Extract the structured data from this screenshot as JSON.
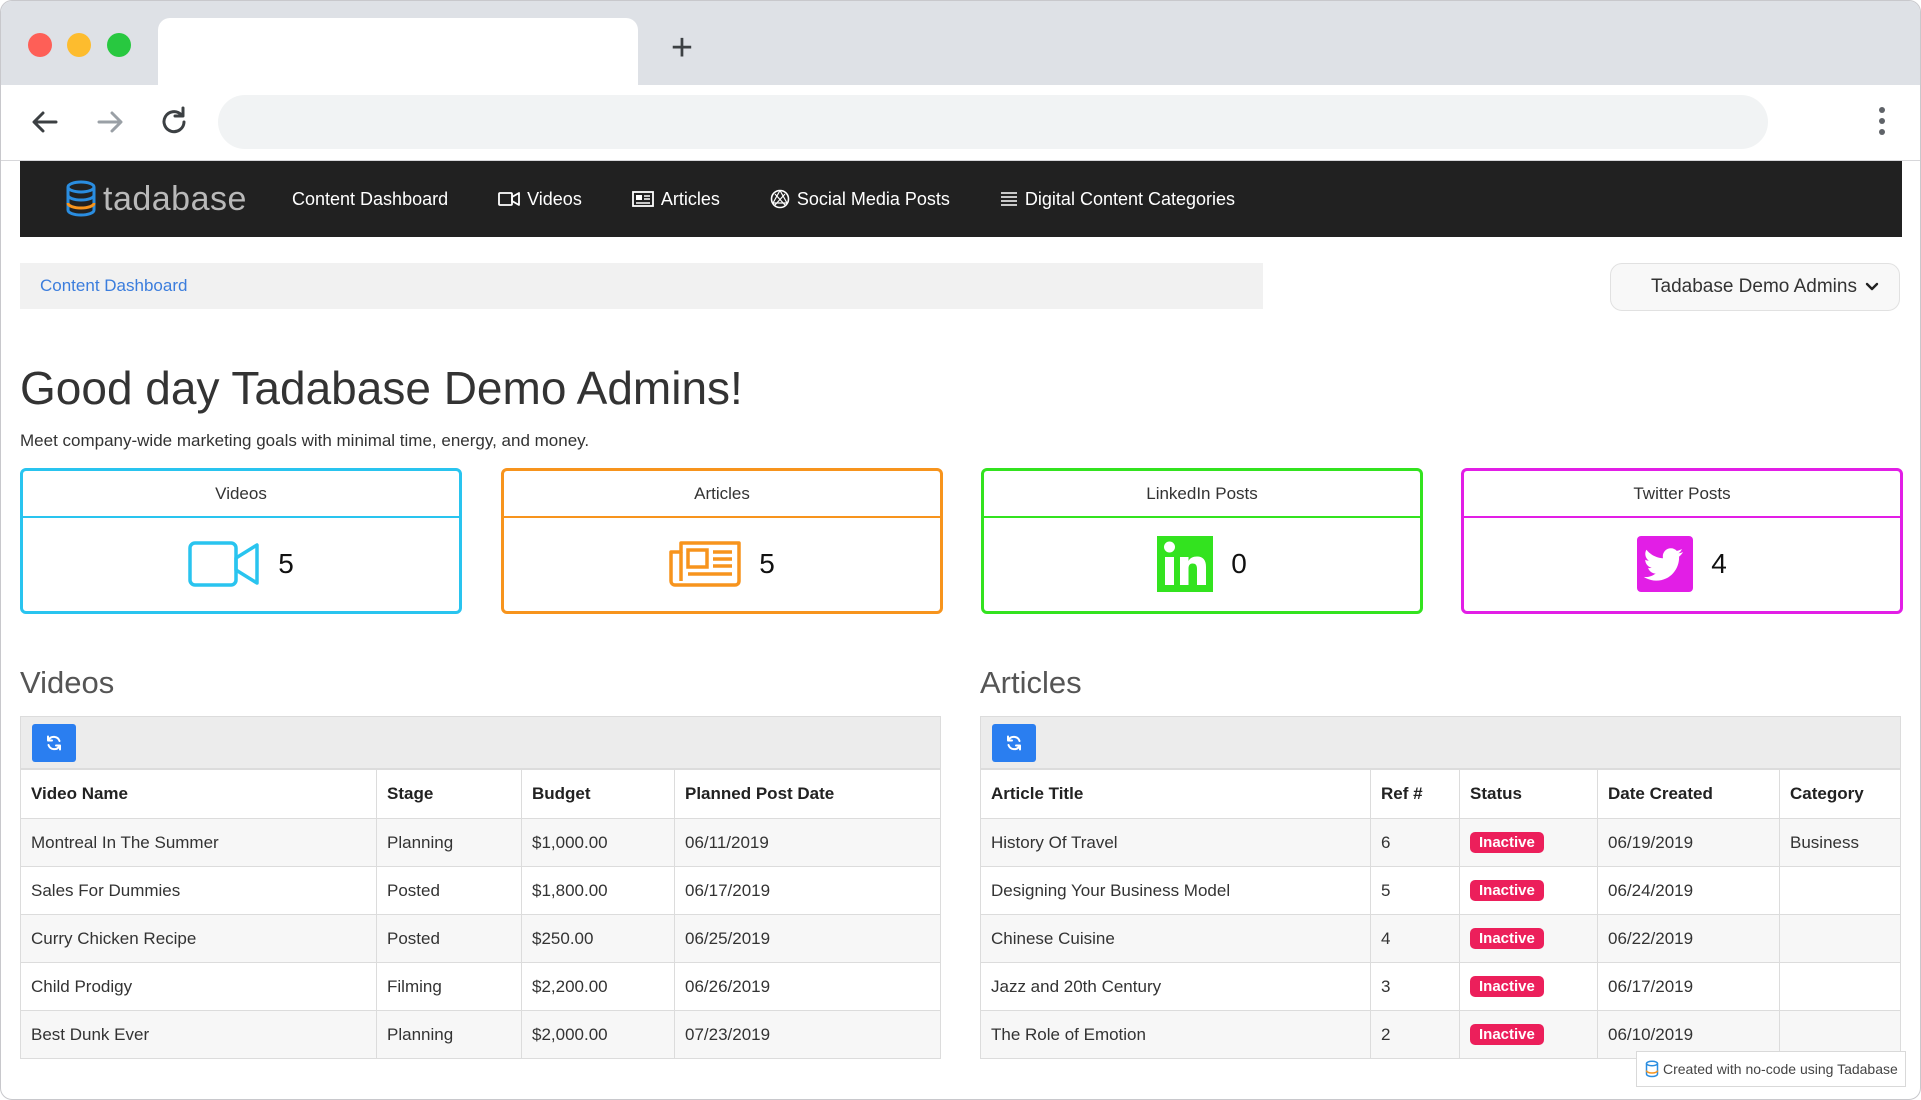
{
  "nav": {
    "logo_text": "tadabase",
    "items": [
      {
        "label": "Content Dashboard",
        "icon": "none"
      },
      {
        "label": "Videos",
        "icon": "video-icon"
      },
      {
        "label": "Articles",
        "icon": "newspaper-icon"
      },
      {
        "label": "Social Media Posts",
        "icon": "globe-icon"
      },
      {
        "label": "Digital Content Categories",
        "icon": "list-icon"
      }
    ]
  },
  "breadcrumb": "Content Dashboard",
  "user_menu": {
    "label": "Tadabase Demo Admins"
  },
  "greeting": "Good day Tadabase Demo Admins!",
  "subtitle": "Meet company-wide marketing goals with minimal time, energy, and money.",
  "stats": [
    {
      "title": "Videos",
      "count": "5",
      "icon": "video-camera-icon",
      "color": "#29c4ef"
    },
    {
      "title": "Articles",
      "count": "5",
      "icon": "newspaper-icon",
      "color": "#f7941d"
    },
    {
      "title": "LinkedIn Posts",
      "count": "0",
      "icon": "linkedin-icon",
      "color": "#33e31f"
    },
    {
      "title": "Twitter Posts",
      "count": "4",
      "icon": "twitter-icon",
      "color": "#e21ee6"
    }
  ],
  "videos": {
    "title": "Videos",
    "columns": [
      "Video Name",
      "Stage",
      "Budget",
      "Planned Post Date"
    ],
    "rows": [
      [
        "Montreal In The Summer",
        "Planning",
        "$1,000.00",
        "06/11/2019"
      ],
      [
        "Sales For Dummies",
        "Posted",
        "$1,800.00",
        "06/17/2019"
      ],
      [
        "Curry Chicken Recipe",
        "Posted",
        "$250.00",
        "06/25/2019"
      ],
      [
        "Child Prodigy",
        "Filming",
        "$2,200.00",
        "06/26/2019"
      ],
      [
        "Best Dunk Ever",
        "Planning",
        "$2,000.00",
        "07/23/2019"
      ]
    ]
  },
  "articles": {
    "title": "Articles",
    "columns": [
      "Article Title",
      "Ref #",
      "Status",
      "Date Created",
      "Category"
    ],
    "rows": [
      [
        "History Of Travel",
        "6",
        "Inactive",
        "06/19/2019",
        "Business"
      ],
      [
        "Designing Your Business Model",
        "5",
        "Inactive",
        "06/24/2019",
        ""
      ],
      [
        "Chinese Cuisine",
        "4",
        "Inactive",
        "06/22/2019",
        ""
      ],
      [
        "Jazz and 20th Century",
        "3",
        "Inactive",
        "06/17/2019",
        ""
      ],
      [
        "The Role of Emotion",
        "2",
        "Inactive",
        "06/10/2019",
        ""
      ]
    ]
  },
  "footer_badge": "Created with no-code using Tadabase",
  "colors": {
    "nav_bg": "#212121",
    "accent": "#2a7ef0",
    "badge": "#ec1f5b",
    "link": "#3b7ddd"
  }
}
